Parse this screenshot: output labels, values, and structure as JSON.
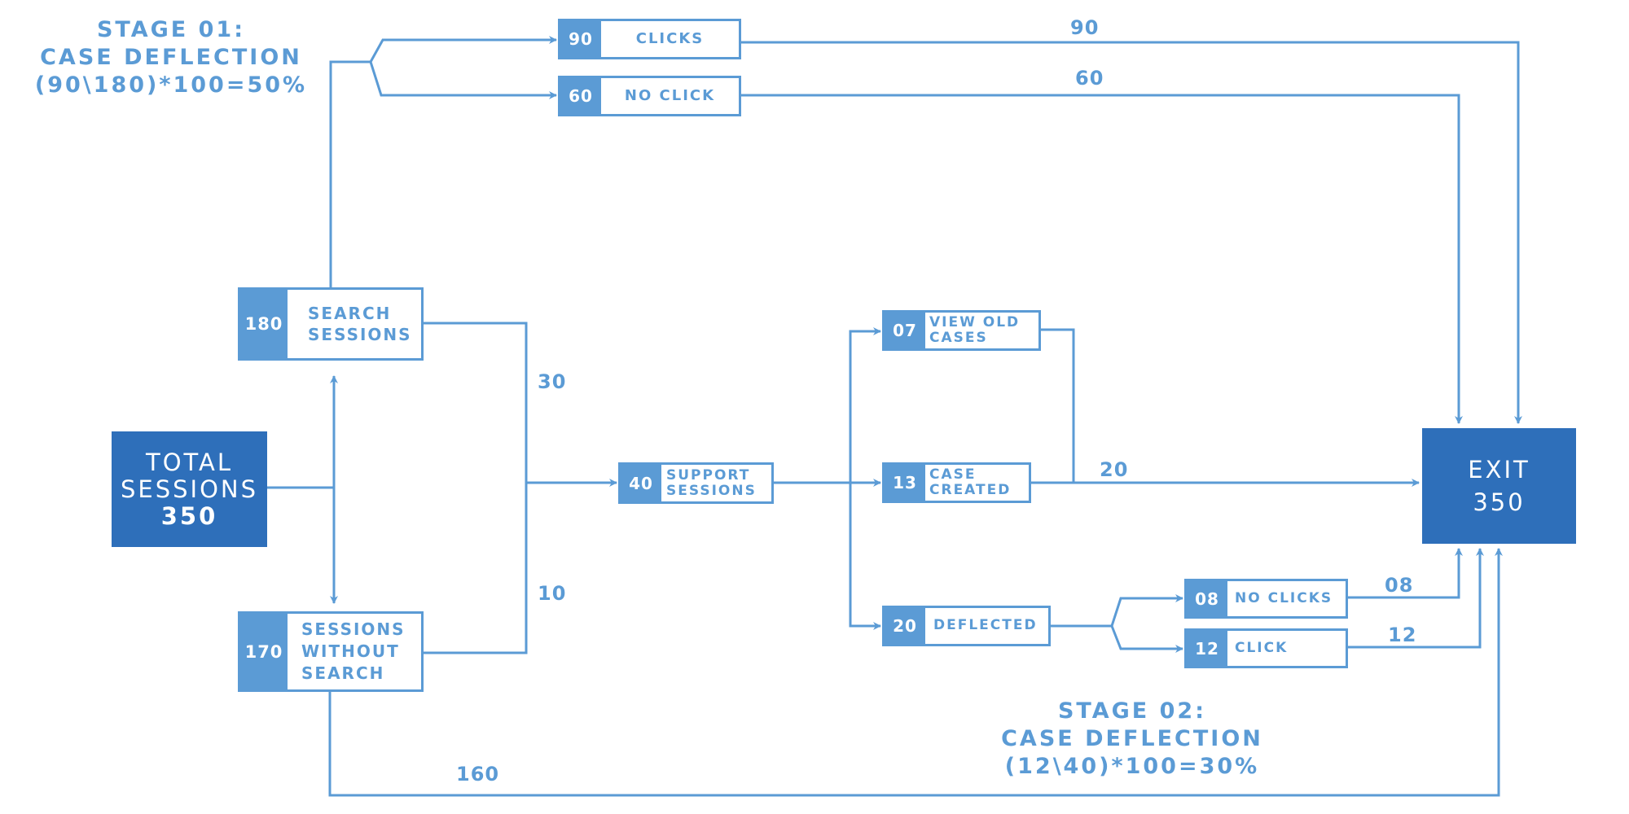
{
  "theme": {
    "accent": "#5b9bd5",
    "dark_box": "#2e6fba",
    "background": "#ffffff"
  },
  "stage1": {
    "title": "STAGE 01:",
    "subtitle": "CASE DEFLECTION",
    "formula": "(90\\180)*100=50%"
  },
  "stage2": {
    "title": "STAGE 02:",
    "subtitle": "CASE DEFLECTION",
    "formula": "(12\\40)*100=30%"
  },
  "total": {
    "line1": "TOTAL",
    "line2": "SESSIONS",
    "value": "350"
  },
  "exit": {
    "label": "EXIT",
    "value": "350"
  },
  "nodes": {
    "clicks": {
      "value": "90",
      "label": "CLICKS"
    },
    "no_click": {
      "value": "60",
      "label": "NO CLICK"
    },
    "search_sessions": {
      "value": "180",
      "label": "SEARCH\nSESSIONS"
    },
    "sessions_without_search": {
      "value": "170",
      "label": "SESSIONS\nWITHOUT\nSEARCH"
    },
    "support_sessions": {
      "value": "40",
      "label": "SUPPORT\nSESSIONS"
    },
    "view_old_cases": {
      "value": "07",
      "label": "VIEW OLD\nCASES"
    },
    "case_created": {
      "value": "13",
      "label": "CASE\nCREATED"
    },
    "deflected": {
      "value": "20",
      "label": "DEFLECTED"
    },
    "no_clicks": {
      "value": "08",
      "label": "NO CLICKS"
    },
    "click": {
      "value": "12",
      "label": "CLICK"
    }
  },
  "flow_labels": {
    "clicks_to_exit": "90",
    "no_click_to_exit": "60",
    "search_to_support": "30",
    "without_search_to_support": "10",
    "cases_to_exit": "20",
    "no_clicks_to_exit": "08",
    "click_to_exit": "12",
    "without_search_to_exit": "160"
  }
}
